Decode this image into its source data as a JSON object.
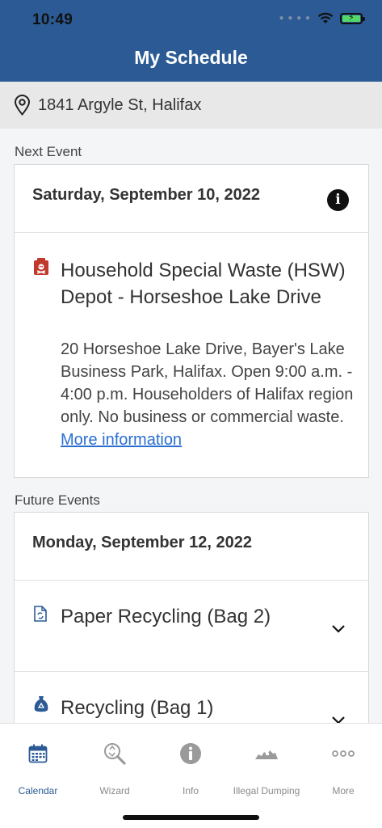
{
  "status": {
    "time": "10:49"
  },
  "header": {
    "title": "My Schedule"
  },
  "address": {
    "text": "1841 Argyle St, Halifax"
  },
  "next_event": {
    "section_label": "Next Event",
    "date": "Saturday, September 10, 2022",
    "item": {
      "icon": "hazardous-waste-icon",
      "title": "Household Special Waste (HSW) Depot - Horseshoe Lake Drive",
      "description": "20 Horseshoe Lake Drive, Bayer's Lake Business Park, Halifax. Open 9:00 a.m. - 4:00 p.m. Householders of Halifax region only. No business or commercial waste.",
      "link_text": "More information"
    }
  },
  "future_events": {
    "section_label": "Future Events",
    "date": "Monday, September 12, 2022",
    "items": [
      {
        "icon": "paper-recycling-icon",
        "title": "Paper Recycling (Bag 2)"
      },
      {
        "icon": "recycling-bag-icon",
        "title": "Recycling (Bag 1)"
      }
    ]
  },
  "tabs": [
    {
      "label": "Calendar",
      "icon": "calendar-icon",
      "active": true
    },
    {
      "label": "Wizard",
      "icon": "wizard-icon",
      "active": false
    },
    {
      "label": "Info",
      "icon": "info-icon",
      "active": false
    },
    {
      "label": "Illegal Dumping",
      "icon": "illegal-dumping-icon",
      "active": false
    },
    {
      "label": "More",
      "icon": "more-icon",
      "active": false
    }
  ],
  "colors": {
    "header": "#2b5a94",
    "link": "#2a6fd0",
    "active_tab": "#2b5a94",
    "hazard_red": "#c0392b",
    "paper_blue": "#2b5a94"
  }
}
